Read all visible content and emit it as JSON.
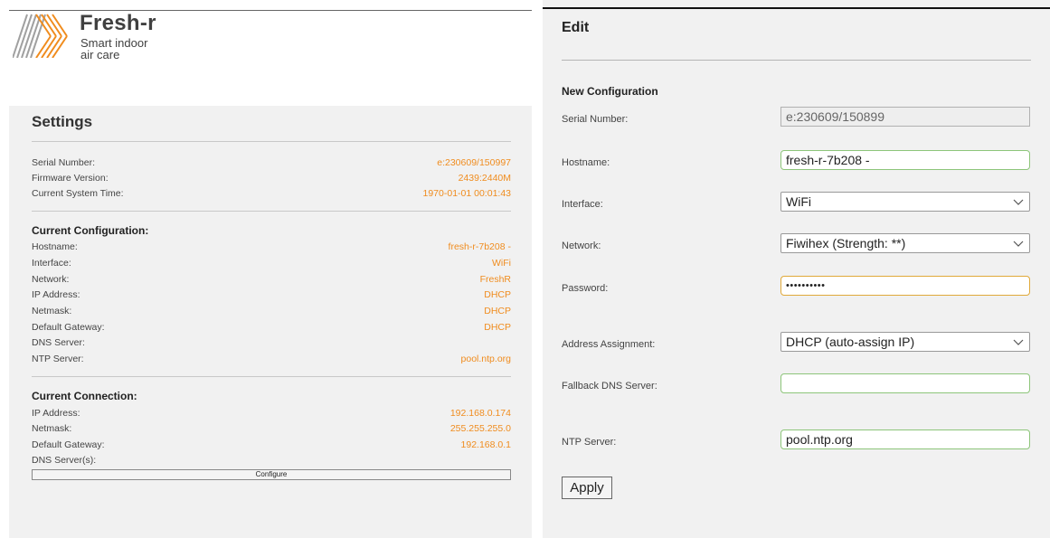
{
  "brand": {
    "name": "Fresh-r",
    "tagline_line1": "Smart indoor",
    "tagline_line2": "air care",
    "colors": {
      "orange": "#f08c1e",
      "gray": "#a0a0a0"
    }
  },
  "settings": {
    "title": "Settings",
    "info": [
      {
        "label": "Serial Number:",
        "value": "e:230609/150997"
      },
      {
        "label": "Firmware Version:",
        "value": "2439:2440M"
      },
      {
        "label": "Current System Time:",
        "value": "1970-01-01 00:01:43"
      }
    ],
    "current_configuration": {
      "title": "Current Configuration:",
      "rows": [
        {
          "label": "Hostname:",
          "value": "fresh-r-7b208 -"
        },
        {
          "label": "Interface:",
          "value": "WiFi"
        },
        {
          "label": "Network:",
          "value": "FreshR"
        },
        {
          "label": "IP Address:",
          "value": "DHCP"
        },
        {
          "label": "Netmask:",
          "value": "DHCP"
        },
        {
          "label": "Default Gateway:",
          "value": "DHCP"
        },
        {
          "label": "DNS Server:",
          "value": ""
        },
        {
          "label": "NTP Server:",
          "value": "pool.ntp.org"
        }
      ]
    },
    "current_connection": {
      "title": "Current Connection:",
      "rows": [
        {
          "label": "IP Address:",
          "value": "192.168.0.174"
        },
        {
          "label": "Netmask:",
          "value": "255.255.255.0"
        },
        {
          "label": "Default Gateway:",
          "value": "192.168.0.1"
        },
        {
          "label": "DNS Server(s):",
          "value": ""
        }
      ]
    },
    "configure_label": "Configure",
    "value_color": "#f08c1e"
  },
  "edit": {
    "title": "Edit",
    "new_config_title": "New Configuration",
    "fields": {
      "serial": {
        "label": "Serial Number:",
        "value": "e:230609/150899"
      },
      "hostname": {
        "label": "Hostname:",
        "value": "fresh-r-7b208 -"
      },
      "interface": {
        "label": "Interface:",
        "value": "WiFi"
      },
      "network": {
        "label": "Network:",
        "value": "Fiwihex (Strength: **)"
      },
      "password": {
        "label": "Password:",
        "value": "••••••••••"
      },
      "address": {
        "label": "Address Assignment:",
        "value": "DHCP (auto-assign IP)"
      },
      "fallback_dns": {
        "label": "Fallback DNS Server:",
        "value": ""
      },
      "ntp": {
        "label": "NTP Server:",
        "value": "pool.ntp.org"
      }
    },
    "apply_label": "Apply",
    "colors": {
      "valid_border": "#8dc57a",
      "focus_border": "#e0a93a"
    }
  }
}
